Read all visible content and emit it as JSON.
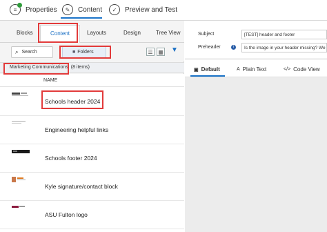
{
  "steps": [
    {
      "label": "Properties",
      "icon": "properties-icon"
    },
    {
      "label": "Content",
      "icon": "edit-icon"
    },
    {
      "label": "Preview and Test",
      "icon": "check-icon"
    }
  ],
  "left_tabs": [
    "Blocks",
    "Content",
    "Layouts",
    "Design",
    "Tree View"
  ],
  "toolbar": {
    "search_label": "Search",
    "folders_label": "Folders"
  },
  "breadcrumb": {
    "folder": "Marketing Communications",
    "count": "(8 items)"
  },
  "list": {
    "column_header": "NAME",
    "items": [
      {
        "name": "Schools header 2024"
      },
      {
        "name": "Engineering helpful links"
      },
      {
        "name": "Schools footer 2024"
      },
      {
        "name": "Kyle signature/contact block"
      },
      {
        "name": "ASU Fulton logo"
      }
    ]
  },
  "form": {
    "subject_label": "Subject",
    "subject_value": "[TEST] header and footer",
    "preheader_label": "Preheader",
    "preheader_value": "Is the image in your header missing? We"
  },
  "right_tabs": [
    {
      "label": "Default",
      "icon": "layout-icon"
    },
    {
      "label": "Plain Text",
      "icon": "text-icon"
    },
    {
      "label": "Code View",
      "icon": "code-icon"
    }
  ],
  "colors": {
    "accent": "#1a73c8",
    "highlight": "#e23a3a",
    "success": "#2e9b3a"
  }
}
